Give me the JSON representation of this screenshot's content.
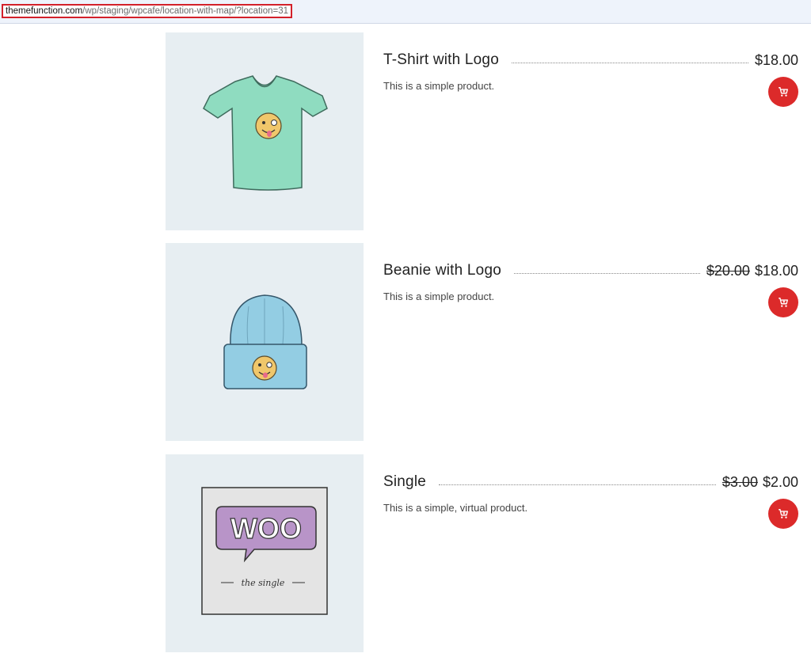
{
  "browser": {
    "url_domain": "themefunction.com",
    "url_path": "/wp/staging/wpcafe/location-with-map/?location=31"
  },
  "products": [
    {
      "title": "T-Shirt with Logo",
      "old_price": "",
      "price": "$18.00",
      "description": "This is a simple product.",
      "image_icon": "tshirt-image"
    },
    {
      "title": "Beanie with Logo",
      "old_price": "$20.00",
      "price": "$18.00",
      "description": "This is a simple product.",
      "image_icon": "beanie-image"
    },
    {
      "title": "Single",
      "old_price": "$3.00",
      "price": "$2.00",
      "description": "This is a simple, virtual product.",
      "image_icon": "woo-single-image",
      "image_text": "WOO",
      "image_caption": "the single"
    }
  ],
  "colors": {
    "accent": "#dc2a2a",
    "thumb_bg": "#e7eef2",
    "tshirt": "#8fdcc0",
    "beanie": "#93cde3",
    "woo_purple": "#b894c8"
  }
}
